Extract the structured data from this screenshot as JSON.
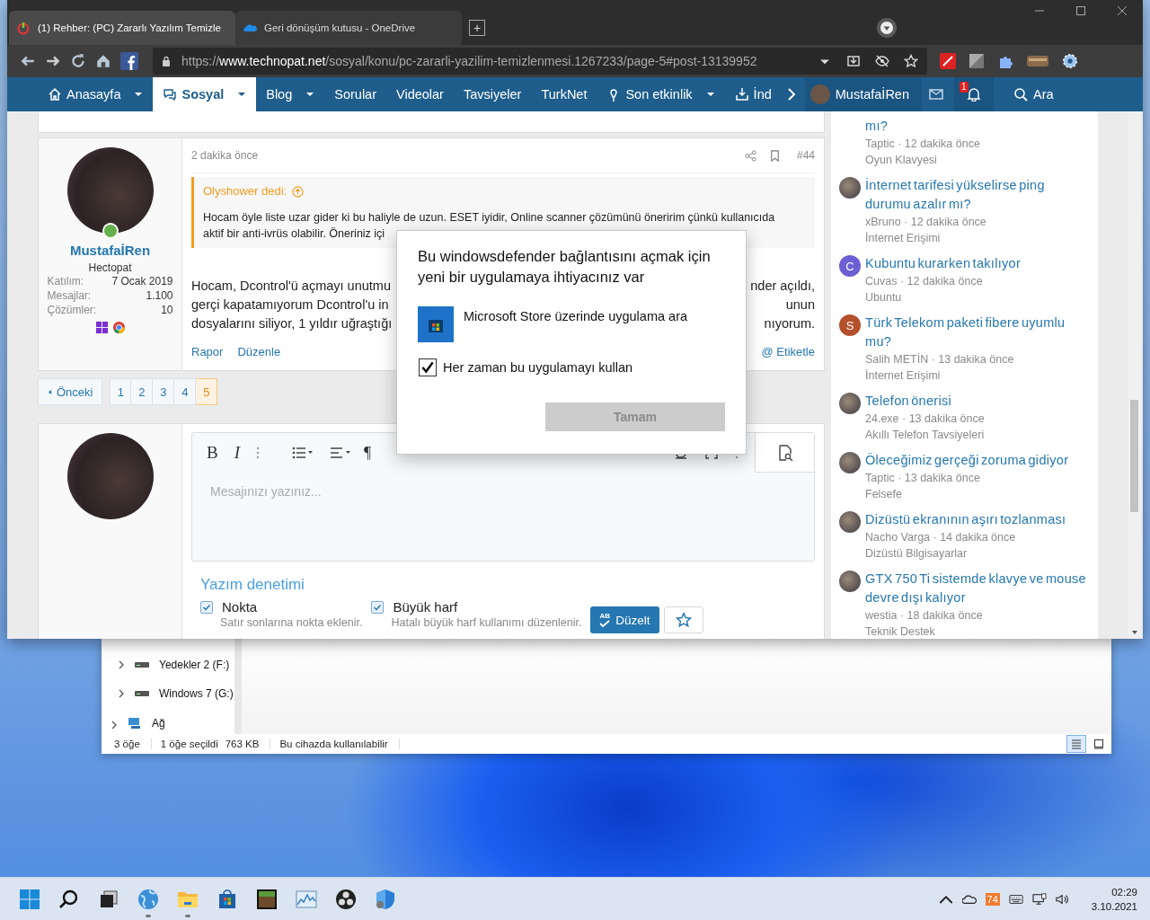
{
  "browser": {
    "tabs": [
      {
        "title": "(1) Rehber: (PC) Zararlı Yazılım Temizle",
        "selected": true
      },
      {
        "title": "Geri dönüşüm kutusu - OneDrive",
        "selected": false
      }
    ],
    "new_tab": "+",
    "url": {
      "scheme": "https://",
      "host": "www.technopat.net",
      "path": "/sosyal/konu/pc-zararli-yazilim-temizlenmesi.1267233/page-5#post-13139952"
    },
    "nav": {
      "items": [
        {
          "label": "Anasayfa",
          "dropdown": true,
          "selected": false
        },
        {
          "label": "Sosyal",
          "dropdown": true,
          "selected": true
        },
        {
          "label": "Blog",
          "dropdown": true,
          "selected": false
        },
        {
          "label": "Sorular",
          "dropdown": false,
          "selected": false
        },
        {
          "label": "Videolar",
          "dropdown": false,
          "selected": false
        },
        {
          "label": "Tavsiyeler",
          "dropdown": false,
          "selected": false
        },
        {
          "label": "TurkNet",
          "dropdown": false,
          "selected": false
        },
        {
          "label": "Son etkinlik",
          "dropdown": true,
          "selected": false
        },
        {
          "label": "İnd",
          "dropdown": false,
          "selected": false
        }
      ],
      "user": "MustafaİRen",
      "notifications": "1",
      "search": "Ara"
    }
  },
  "post": {
    "time": "2 dakika önce",
    "number": "#44",
    "author": {
      "name": "MustafaİRen",
      "title": "Hectopat",
      "online": true,
      "stats": [
        {
          "label": "Katılım:",
          "value": "7 Ocak 2019"
        },
        {
          "label": "Mesajlar:",
          "value": "1.100"
        },
        {
          "label": "Çözümler:",
          "value": "10"
        }
      ]
    },
    "quote": {
      "author": "Olyshower dedi:",
      "lines": [
        "Hocam öyle liste uzar gider ki bu haliyle de uzun. ESET iyidir, Online scanner çözümünü öneririm çünkü kullanıcıda",
        "aktif bir anti-ivrüs olabilir. Öneriniz içi"
      ]
    },
    "body": [
      {
        "left": "Hocam, Dcontrol'ü açmayı unutmu",
        "right": "nder açıldı,"
      },
      {
        "left": "gerçi kapatamıyorum Dcontrol'u in",
        "right": "unun"
      },
      {
        "left": "dosyalarını siliyor, 1 yıldır uğraştığı",
        "right": "nıyorum."
      }
    ],
    "actions": [
      "Rapor",
      "Düzenle"
    ],
    "tag": "@ Etiketle"
  },
  "pagination": {
    "prev": "Önceki",
    "pages": [
      {
        "label": "1",
        "selected": false
      },
      {
        "label": "2",
        "selected": false
      },
      {
        "label": "3",
        "selected": false
      },
      {
        "label": "4",
        "selected": false
      },
      {
        "label": "5",
        "selected": true
      }
    ]
  },
  "editor": {
    "format": [
      "B",
      "I"
    ],
    "paragraph": "¶",
    "placeholder": "Mesajınızı yazınız...",
    "spell": {
      "title": "Yazım denetimi",
      "options": [
        {
          "label": "Nokta",
          "hint": "Satır sonlarına nokta eklenir.",
          "checked": true
        },
        {
          "label": "Büyük harf",
          "hint": "Hatalı büyük harf kullanımı düzenlenir.",
          "checked": true
        }
      ],
      "fix": {
        "badge": "AB",
        "label": "Düzelt"
      }
    }
  },
  "sidebar": {
    "threads": [
      {
        "title": "mı?",
        "meta": "Taptic · 12 dakika önce",
        "forum": "Oyun Klavyesi"
      },
      {
        "title": "İnternet tarifesi yükselirse ping durumu azalır mı?",
        "meta": "xBruno · 12 dakika önce",
        "forum": "İnternet Erişimi",
        "avatar": {
          "kind": "photo"
        }
      },
      {
        "title": "Kubuntu kurarken takılıyor",
        "meta": "Cuvas · 12 dakika önce",
        "forum": "Ubuntu",
        "avatar": {
          "kind": "letter",
          "letter": "C",
          "color": "#6c5fd3"
        }
      },
      {
        "title": "Türk Telekom paketi fibere uyumlu mu?",
        "meta": "Salih METİN · 13 dakika önce",
        "forum": "İnternet Erişimi",
        "avatar": {
          "kind": "letter",
          "letter": "S",
          "color": "#b5502c"
        }
      },
      {
        "title": "Telefon önerisi",
        "meta": "24.exe · 13 dakika önce",
        "forum": "Akıllı Telefon Tavsiyeleri",
        "avatar": {
          "kind": "photo"
        }
      },
      {
        "title": "Öleceğimiz gerçeği zoruma gidiyor",
        "meta": "Taptic · 13 dakika önce",
        "forum": "Felsefe",
        "avatar": {
          "kind": "photo"
        }
      },
      {
        "title": "Dizüstü ekranının aşırı tozlanması",
        "meta": "Nacho Varga · 14 dakika önce",
        "forum": "Dizüstü Bilgisayarlar",
        "avatar": {
          "kind": "photo"
        }
      },
      {
        "title": "GTX 750 Ti sistemde klavye ve mouse devre dışı kalıyor",
        "meta": "westia · 18 dakika önce",
        "forum": "Teknik Destek",
        "avatar": {
          "kind": "photo"
        }
      }
    ]
  },
  "dialog": {
    "title": "Bu windowsdefender bağlantısını açmak için yeni bir uygulamaya ihtiyacınız var",
    "option": "Microsoft Store üzerinde uygulama ara",
    "always": {
      "label": "Her zaman bu uygulamayı kullan",
      "checked": true
    },
    "ok": {
      "label": "Tamam",
      "disabled": true
    }
  },
  "explorer": {
    "tree": [
      {
        "label": "Yedekler 2 (F:)",
        "kind": "drive"
      },
      {
        "label": "Windows 7 (G:)",
        "kind": "drive"
      },
      {
        "label": "Ağ",
        "kind": "network"
      }
    ],
    "status": [
      "3 öğe",
      "1 öğe seçildi",
      "763 KB",
      "Bu cihazda kullanılabilir"
    ],
    "views": [
      {
        "kind": "details",
        "selected": true
      },
      {
        "kind": "tiles",
        "selected": false
      }
    ]
  },
  "taskbar": {
    "apps": [
      {
        "kind": "start",
        "running": false
      },
      {
        "kind": "search",
        "running": false
      },
      {
        "kind": "taskview",
        "running": false
      },
      {
        "kind": "globe",
        "running": true
      },
      {
        "kind": "folder",
        "running": true
      },
      {
        "kind": "store",
        "running": false
      },
      {
        "kind": "game",
        "running": false
      },
      {
        "kind": "monitor",
        "running": false
      },
      {
        "kind": "obs",
        "running": false
      },
      {
        "kind": "shield",
        "running": false
      }
    ],
    "tray": {
      "badge": "74",
      "time": "02:29",
      "date": "3.10.2021"
    }
  }
}
